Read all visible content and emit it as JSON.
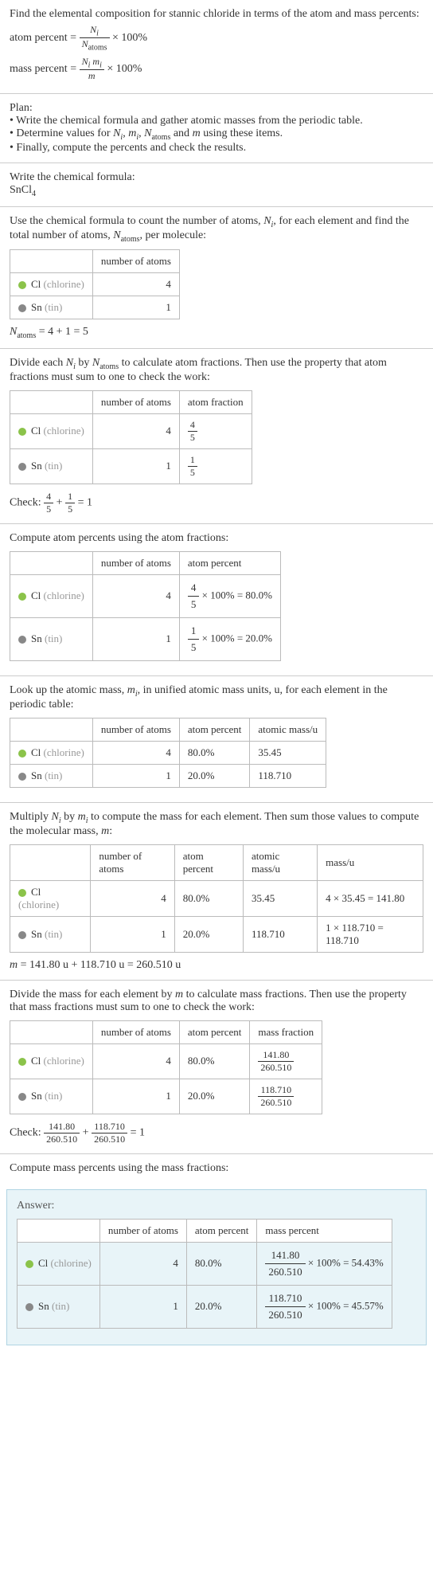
{
  "intro": {
    "title": "Find the elemental composition for stannic chloride in terms of the atom and mass percents:",
    "atom_label": "atom percent = ",
    "atom_num": "N",
    "atom_sub": "i",
    "atom_den": "N",
    "atom_den_sub": "atoms",
    "times100": " × 100%",
    "mass_label": "mass percent = ",
    "mass_num": "N_i m_i",
    "mass_den": "m"
  },
  "plan": {
    "title": "Plan:",
    "b1": "• Write the chemical formula and gather atomic masses from the periodic table.",
    "b2_a": "• Determine values for ",
    "b2_b": " using these items.",
    "b3": "• Finally, compute the percents and check the results."
  },
  "formula": {
    "title": "Write the chemical formula:",
    "value": "SnCl",
    "sub": "4"
  },
  "count": {
    "title_a": "Use the chemical formula to count the number of atoms, ",
    "title_b": ", for each element and find the total number of atoms, ",
    "title_c": ", per molecule:",
    "h1": "",
    "h2": "number of atoms",
    "cl_name": "Cl ",
    "cl_paren": "(chlorine)",
    "cl_n": "4",
    "sn_name": "Sn ",
    "sn_paren": "(tin)",
    "sn_n": "1",
    "total": " = 4 + 1 = 5"
  },
  "atomfrac": {
    "title_a": "Divide each ",
    "title_b": " by ",
    "title_c": " to calculate atom fractions. Then use the property that atom fractions must sum to one to check the work:",
    "h3": "atom fraction",
    "cl_num": "4",
    "cl_den": "5",
    "sn_num": "1",
    "sn_den": "5",
    "check_label": "Check: ",
    "check": " = 1"
  },
  "atompct": {
    "title": "Compute atom percents using the atom fractions:",
    "h3": "atom percent",
    "cl_calc": " × 100% = 80.0%",
    "sn_calc": " × 100% = 20.0%"
  },
  "lookup": {
    "title_a": "Look up the atomic mass, ",
    "title_b": ", in unified atomic mass units, u, for each element in the periodic table:",
    "h4": "atomic mass/u",
    "cl_pct": "80.0%",
    "cl_mass": "35.45",
    "sn_pct": "20.0%",
    "sn_mass": "118.710"
  },
  "multiply": {
    "title_a": "Multiply ",
    "title_b": " by ",
    "title_c": " to compute the mass for each element. Then sum those values to compute the molecular mass, ",
    "title_d": ":",
    "h5": "mass/u",
    "cl_calc": "4 × 35.45 = 141.80",
    "sn_calc": "1 × 118.710 = 118.710",
    "total": " = 141.80 u + 118.710 u = 260.510 u"
  },
  "massfrac": {
    "title_a": "Divide the mass for each element by ",
    "title_b": " to calculate mass fractions. Then use the property that mass fractions must sum to one to check the work:",
    "h3": "mass fraction",
    "cl_num": "141.80",
    "cl_den": "260.510",
    "sn_num": "118.710",
    "sn_den": "260.510",
    "check": " = 1"
  },
  "masspct": {
    "title": "Compute mass percents using the mass fractions:"
  },
  "answer": {
    "label": "Answer:",
    "h3": "mass percent",
    "cl_calc": " × 100% = 54.43%",
    "sn_calc": " × 100% = 45.57%"
  },
  "chart_data": {
    "type": "table",
    "compound": "SnCl4",
    "elements": [
      {
        "symbol": "Cl",
        "name": "chlorine",
        "atoms": 4,
        "atom_fraction": "4/5",
        "atom_percent": 80.0,
        "atomic_mass_u": 35.45,
        "mass_u": 141.8,
        "mass_fraction": "141.80/260.510",
        "mass_percent": 54.43
      },
      {
        "symbol": "Sn",
        "name": "tin",
        "atoms": 1,
        "atom_fraction": "1/5",
        "atom_percent": 20.0,
        "atomic_mass_u": 118.71,
        "mass_u": 118.71,
        "mass_fraction": "118.710/260.510",
        "mass_percent": 45.57
      }
    ],
    "N_atoms": 5,
    "molecular_mass_u": 260.51
  }
}
